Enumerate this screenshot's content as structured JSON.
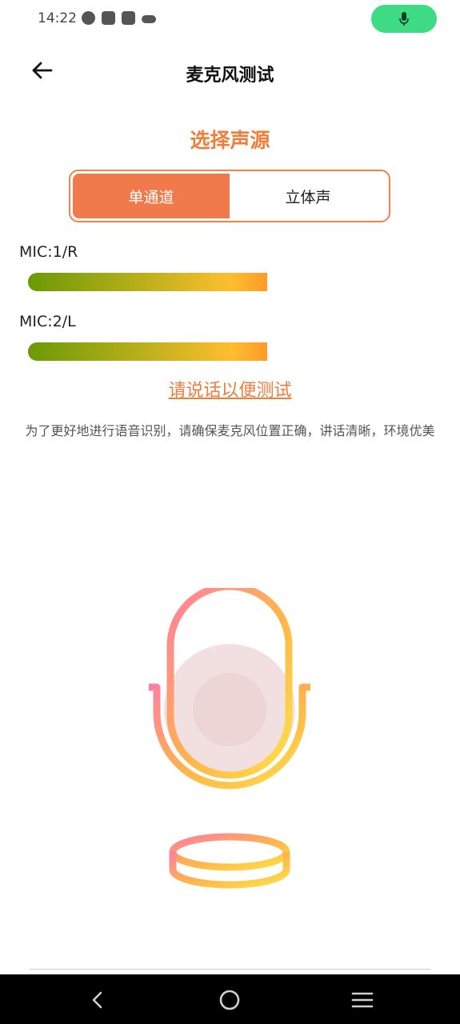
{
  "status_bar": {
    "time": "14:22",
    "icons": [
      "speedometer-icon",
      "shopping-bag-icon",
      "shopping-bag-icon",
      "cloud-icon"
    ],
    "mic_indicator_color": "#3ddc84"
  },
  "header": {
    "title": "麦克风测试",
    "back_icon": "arrow-left-icon"
  },
  "source": {
    "title": "选择声源",
    "options": [
      "单通道",
      "立体声"
    ],
    "selected": "单通道",
    "accent": "#f07a4a"
  },
  "channels": [
    {
      "label": "MIC:1/R",
      "level": 0.52
    },
    {
      "label": "MIC:2/L",
      "level": 0.52
    }
  ],
  "prompt": {
    "link": "请说话以便测试",
    "hint": "为了更好地进行语音识别，请确保麦克风位置正确，讲话清晰，环境优美"
  },
  "nav": {
    "back_icon": "chevron-left-icon",
    "home_icon": "circle-home-icon",
    "menu_icon": "hamburger-menu-icon"
  }
}
